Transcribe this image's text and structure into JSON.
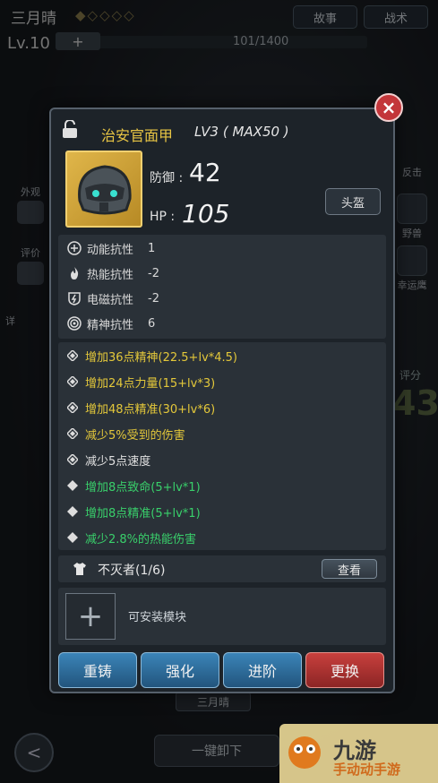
{
  "hud": {
    "char_name": "三月晴",
    "level": "Lv.10",
    "plus": "+",
    "exp": "101/1400",
    "story_label": "故事",
    "battle_label": "战术"
  },
  "left_side": {
    "outfit": "外观",
    "review": "评价",
    "detail": "详"
  },
  "right_side": {
    "counter": "反击",
    "beast": "野兽",
    "lucky": "幸运鹰",
    "score_label": "评分",
    "score_value": "43"
  },
  "bottom": {
    "tab_label": "三月晴",
    "unequip_label": "一键卸下",
    "back": "<"
  },
  "watermark": {
    "line1": "九游",
    "line2": "手动动手游"
  },
  "item": {
    "close": "×",
    "name": "治安官面甲",
    "level_text": "LV3 ( MAX50 )",
    "defense_label": "防御 :",
    "defense_value": "42",
    "hp_label": "HP :",
    "hp_value": "105",
    "slot_type": "头盔",
    "resistances": [
      {
        "label": "动能抗性",
        "value": "1"
      },
      {
        "label": "热能抗性",
        "value": "-2"
      },
      {
        "label": "电磁抗性",
        "value": "-2"
      },
      {
        "label": "精神抗性",
        "value": "6"
      }
    ],
    "bonuses": [
      {
        "text": "增加36点精神(22.5+lv*4.5)",
        "color": "yellow"
      },
      {
        "text": "增加24点力量(15+lv*3)",
        "color": "yellow"
      },
      {
        "text": "增加48点精准(30+lv*6)",
        "color": "yellow"
      },
      {
        "text": "减少5%受到的伤害",
        "color": "yellow"
      },
      {
        "text": "减少5点速度",
        "color": "white"
      },
      {
        "text": "增加8点致命(5+lv*1)",
        "color": "green"
      },
      {
        "text": "增加8点精准(5+lv*1)",
        "color": "green"
      },
      {
        "text": "减少2.8%的热能伤害",
        "color": "green"
      }
    ],
    "set_name": "不灭者(1/6)",
    "view_label": "查看",
    "module_text": "可安装模块",
    "module_plus": "+",
    "actions": [
      "重铸",
      "强化",
      "进阶",
      "更换"
    ]
  },
  "colors": {
    "yellow": "#e4c83a",
    "white": "#e0e0e0",
    "green": "#39d06b",
    "gold": "#e8c544",
    "close_red": "#c3363a"
  }
}
